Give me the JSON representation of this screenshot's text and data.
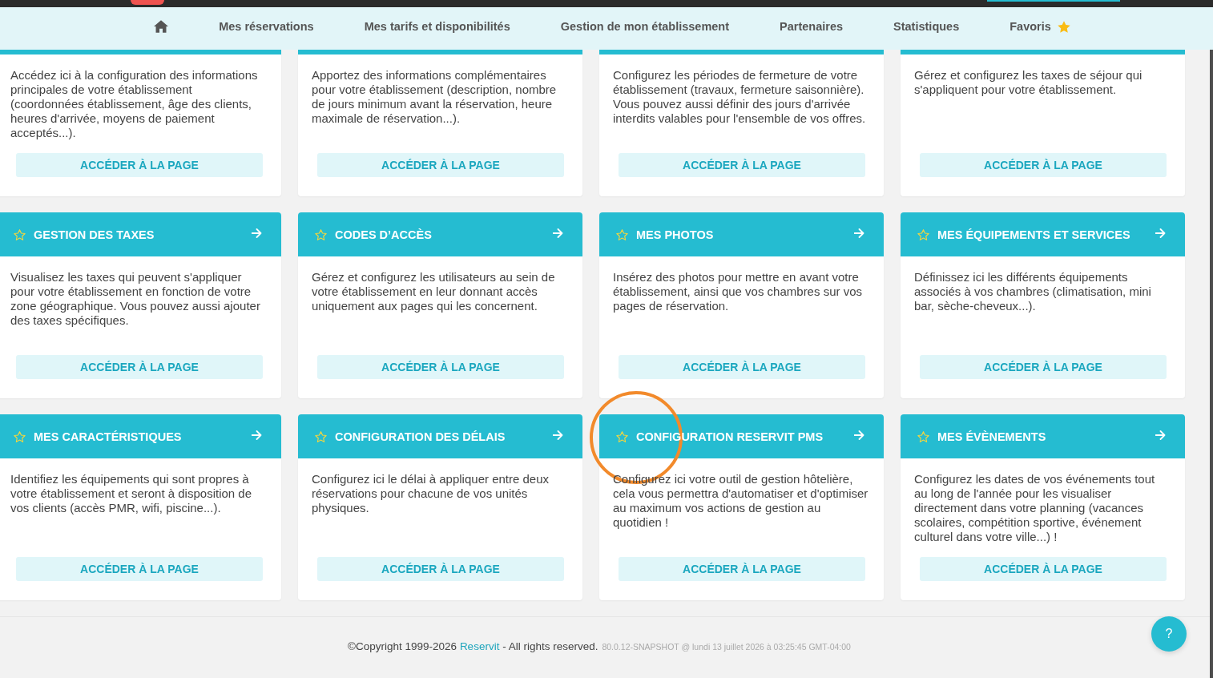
{
  "nav": {
    "items": [
      {
        "kind": "home"
      },
      {
        "kind": "link",
        "label": "Mes réservations"
      },
      {
        "kind": "link",
        "label": "Mes tarifs et disponibilités"
      },
      {
        "kind": "link",
        "label": "Gestion de mon établissement"
      },
      {
        "kind": "link",
        "label": "Partenaires"
      },
      {
        "kind": "link",
        "label": "Statistiques"
      },
      {
        "kind": "favorites",
        "label": "Favoris"
      }
    ]
  },
  "cards": [
    {
      "description": "Accédez ici à la configuration des informations principales de votre établissement (coordonnées établissement, âge des clients, heures d'arrivée, moyens de paiement acceptés...).",
      "button": "ACCÉDER À LA PAGE",
      "highlighted": false
    },
    {
      "description": "Apportez des informations complémentaires pour votre établissement (description, nombre de jours minimum avant la réservation, heure maximale de réservation...).",
      "button": "ACCÉDER À LA PAGE",
      "highlighted": false
    },
    {
      "description": "Configurez les périodes de fermeture de votre établissement (travaux, fermeture saisonnière). Vous pouvez aussi définir des jours d'arrivée interdits valables pour l'ensemble de vos offres.",
      "button": "ACCÉDER À LA PAGE",
      "highlighted": false
    },
    {
      "description": "Gérez et configurez les taxes de séjour qui s'appliquent pour votre établissement.",
      "button": "ACCÉDER À LA PAGE",
      "highlighted": false
    },
    {
      "title": "GESTION DES TAXES",
      "favorite": false,
      "description": "Visualisez les taxes qui peuvent s'appliquer pour votre établissement en fonction de votre zone géographique. Vous pouvez aussi ajouter des taxes spécifiques.",
      "button": "ACCÉDER À LA PAGE",
      "highlighted": false
    },
    {
      "title": "CODES D’ACCÈS",
      "favorite": false,
      "description": "Gérez et configurez les utilisateurs au sein de votre établissement en leur donnant accès uniquement aux pages qui les concernent.",
      "button": "ACCÉDER À LA PAGE",
      "highlighted": false
    },
    {
      "title": "MES PHOTOS",
      "favorite": false,
      "description": "Insérez des photos pour mettre en avant votre établissement, ainsi que vos chambres sur vos pages de réservation.",
      "button": "ACCÉDER À LA PAGE",
      "highlighted": false
    },
    {
      "title": "MES ÉQUIPEMENTS ET SERVICES",
      "favorite": false,
      "description": "Définissez ici les différents équipements associés à vos chambres (climatisation, mini bar, sèche-cheveux...).",
      "button": "ACCÉDER À LA PAGE",
      "highlighted": false
    },
    {
      "title": "MES CARACTÉRISTIQUES",
      "favorite": false,
      "description": "Identifiez les équipements qui sont propres à votre établissement et seront à disposition de vos clients (accès PMR, wifi, piscine...).",
      "button": "ACCÉDER À LA PAGE",
      "highlighted": false
    },
    {
      "title": "CONFIGURATION DES DÉLAIS",
      "favorite": false,
      "description": "Configurez ici le délai à appliquer entre deux réservations pour chacune de vos unités physiques.",
      "button": "ACCÉDER À LA PAGE",
      "highlighted": false
    },
    {
      "title": "CONFIGURATION RESERVIT PMS",
      "favorite": false,
      "description": "Configurez ici votre outil de gestion hôtelière, cela vous permettra d'automatiser et d'optimiser au maximum vos actions de gestion au quotidien !",
      "button": "ACCÉDER À LA PAGE",
      "highlighted": true
    },
    {
      "title": "MES ÉVÈNEMENTS",
      "favorite": false,
      "description": "Configurez les dates de vos événements tout au long de l'année pour les visualiser directement dans votre planning (vacances scolaires, compétition sportive, événement culturel dans votre ville...) !",
      "button": "ACCÉDER À LA PAGE",
      "highlighted": false
    }
  ],
  "footer": {
    "copyright_before": "©Copyright 1999-2026",
    "link": "Reservit",
    "copyright_after": "- All rights reserved.",
    "version": "80.0.12-SNAPSHOT @ lundi 13 juillet 2026 à 03:25:45 GMT-04:00"
  },
  "help_button": {
    "label": "?"
  }
}
